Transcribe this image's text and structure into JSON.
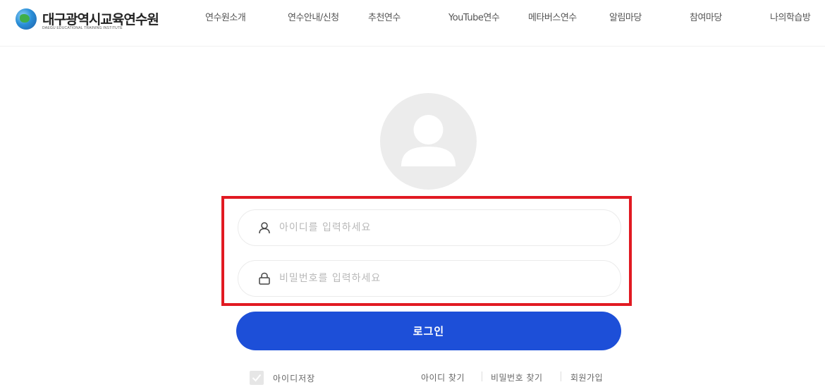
{
  "logo": {
    "title": "대구광역시교육연수원",
    "subtitle": "DAEGU EDUCATIONAL TRAINING INSTITUTE"
  },
  "nav": [
    {
      "label": "연수원소개"
    },
    {
      "label": "연수안내/신청"
    },
    {
      "label": "추천연수"
    },
    {
      "label": "YouTube연수"
    },
    {
      "label": "메타버스연수"
    },
    {
      "label": "알림마당"
    },
    {
      "label": "참여마당"
    },
    {
      "label": "나의학습방"
    }
  ],
  "login": {
    "id_placeholder": "아이디를 입력하세요",
    "id_value": "",
    "pw_placeholder": "비밀번호를 입력하세요",
    "pw_value": "",
    "button_label": "로그인",
    "remember_label": "아이디저장",
    "remember_checked": false,
    "find_id_label": "아이디 찾기",
    "find_pw_label": "비밀번호 찾기",
    "signup_label": "회원가입"
  },
  "colors": {
    "accent": "#1d4fd8",
    "highlight": "#e11a22",
    "avatar_bg": "#ececec"
  },
  "icons": {
    "avatar": "user-avatar-icon",
    "id_field": "user-icon",
    "pw_field": "lock-icon",
    "checkbox": "check-icon"
  }
}
